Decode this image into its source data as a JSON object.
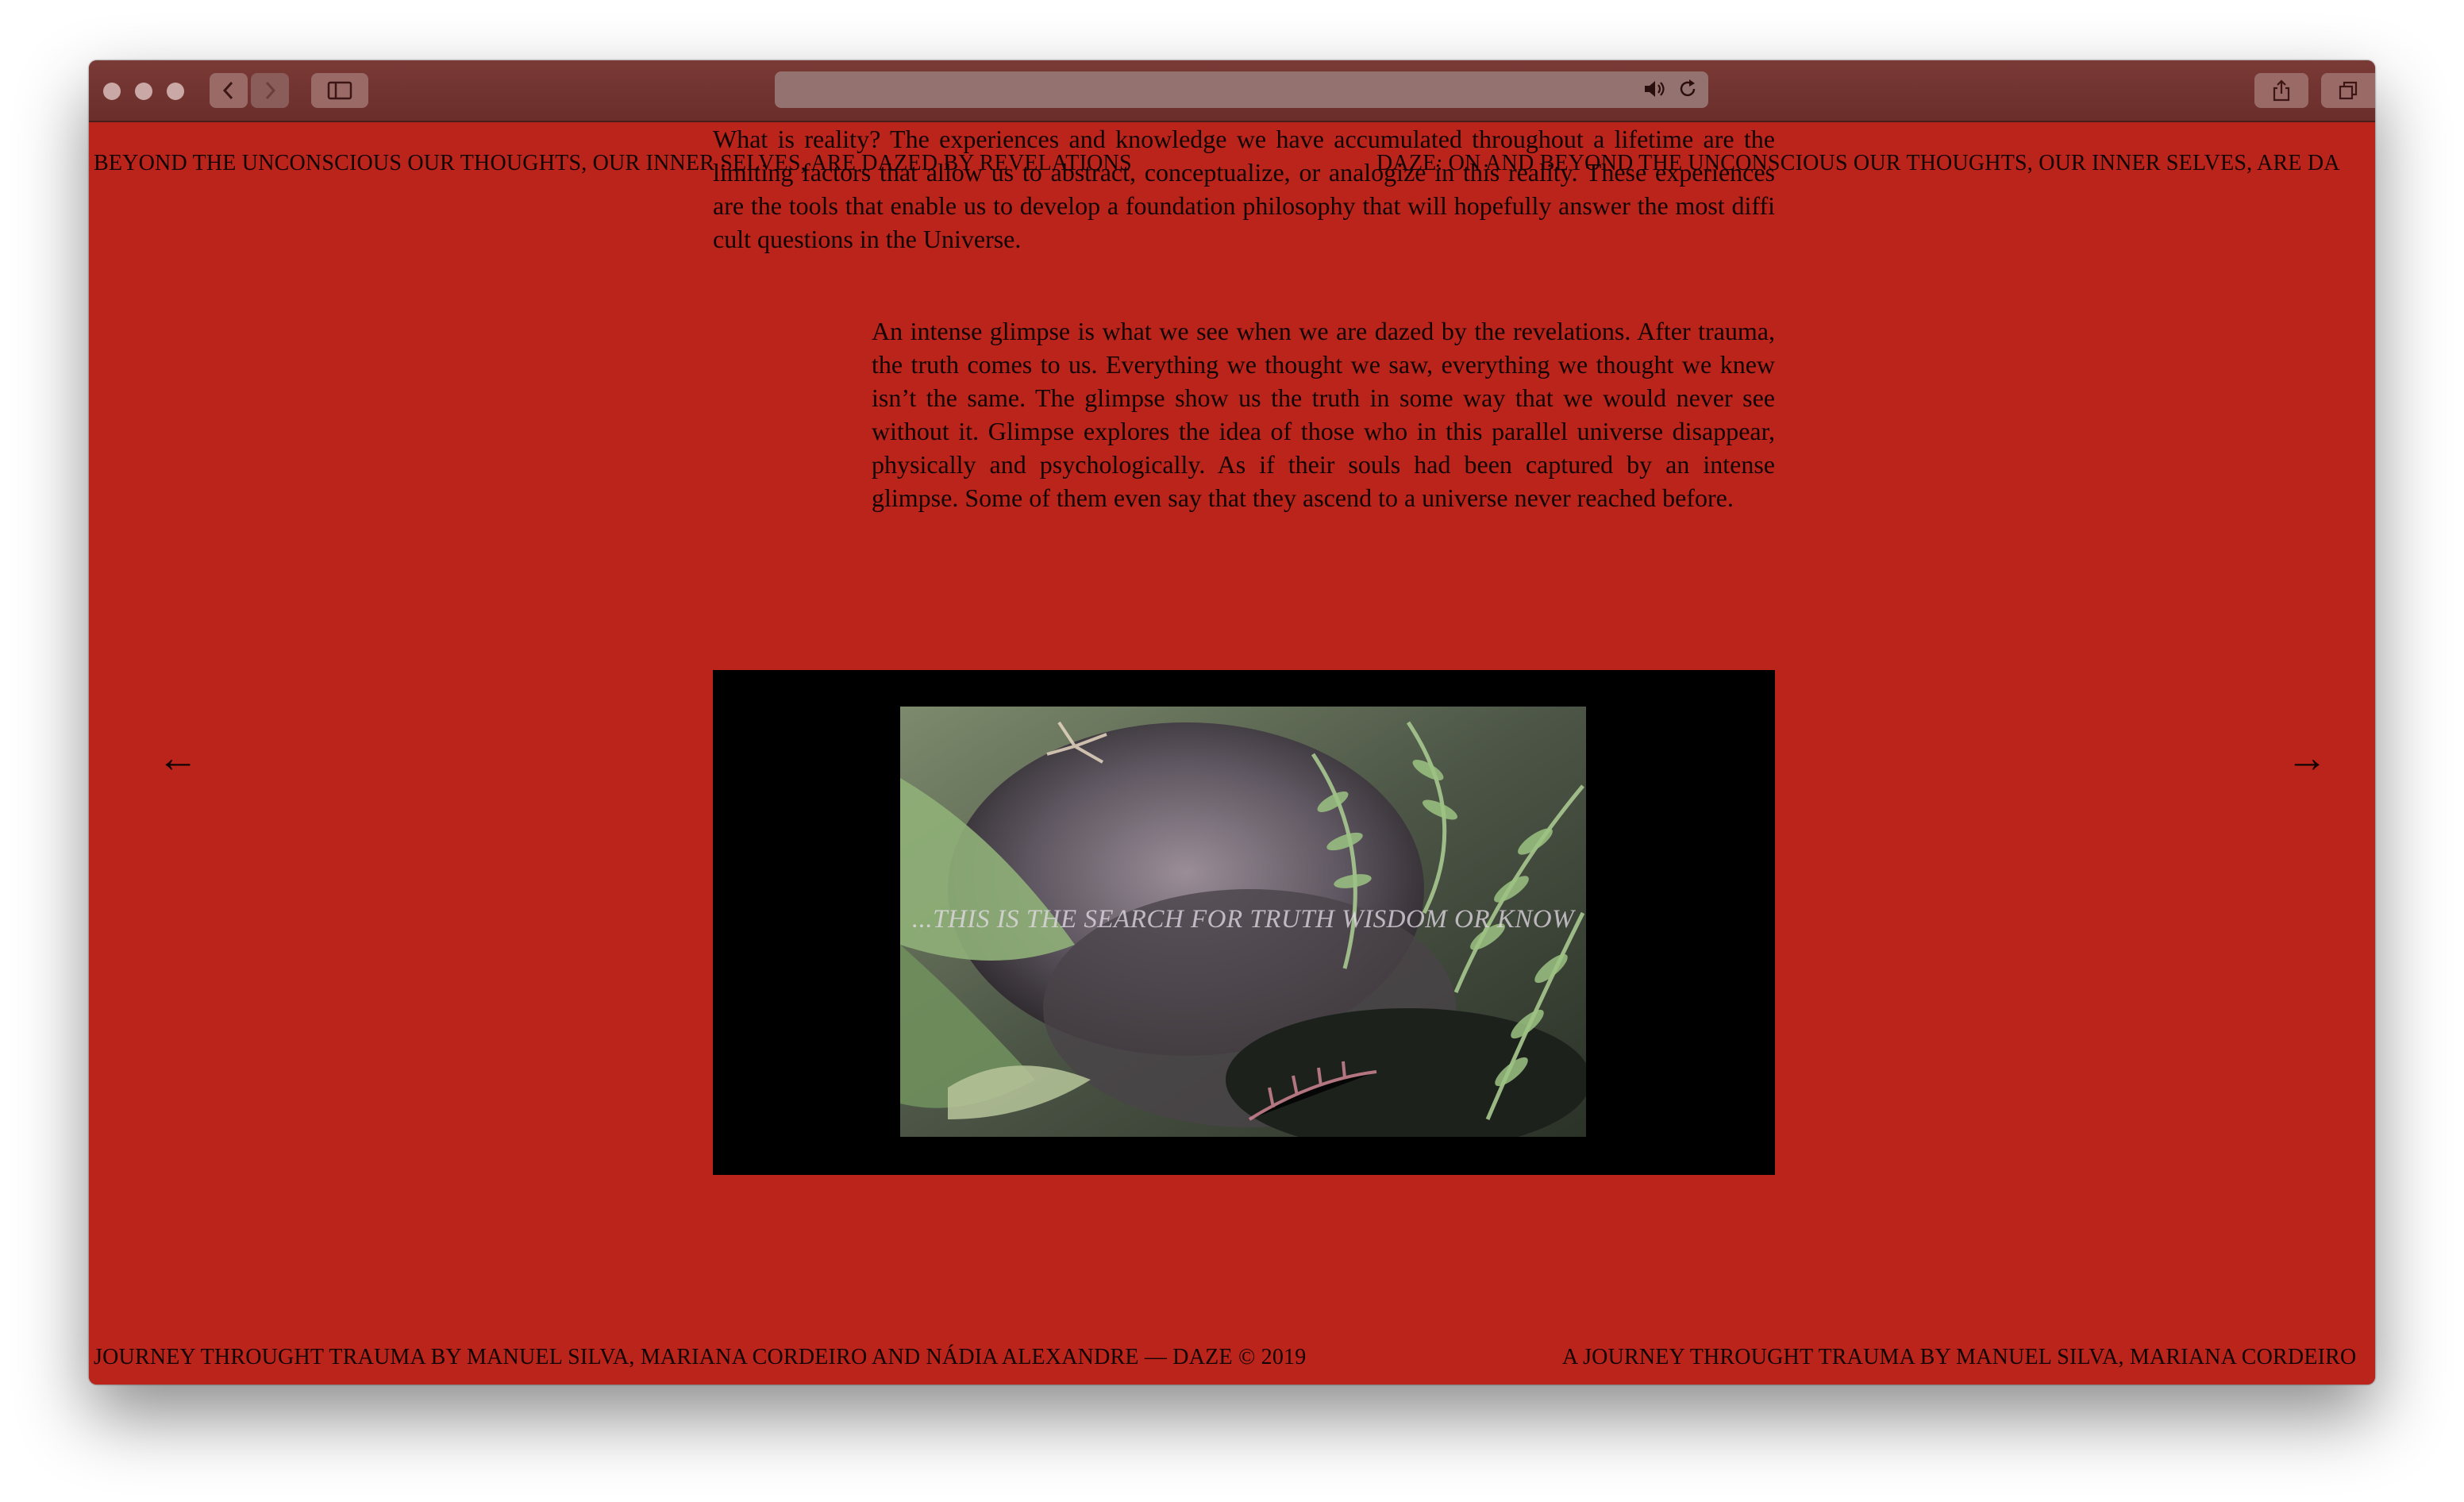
{
  "browser": {
    "back_icon": "chevron-left-icon",
    "forward_icon": "chevron-right-icon",
    "sidebar_icon": "sidebar-icon",
    "audio_icon": "speaker-icon",
    "reload_icon": "reload-icon",
    "share_icon": "share-icon",
    "tabs_icon": "tabs-icon"
  },
  "colors": {
    "page_background": "#ba241a",
    "text": "#120404",
    "toolbar": "#6e302d",
    "video_background": "#000000"
  },
  "page": {
    "top_marquee_left": "BEYOND THE UNCONSCIOUS OUR THOUGHTS, OUR INNER SELVES, ARE DAZED BY REVELATIONS",
    "top_marquee_right": "DAZE: ON AND BEYOND THE UNCONSCIOUS OUR THOUGHTS, OUR INNER SELVES, ARE DA",
    "intro_paragraph": "What is reality? The experiences and knowledge we have accumulated throughout a lifetime are the limiting factors that allow us to abstract, conceptualize, or analogize in this reality. These experiences are the tools that enable us to develop a foundation philosophy that will hopefully answer the most diffi cult questions in the Universe.",
    "glimpse_paragraph": "An intense glimpse is what we see when we are dazed by the revelations. After trauma, the truth comes to us. Everything we thought we saw, everything we thought we knew isn’t the same. The glimpse show us the truth in some way that we would never see without it. Glimpse explores the idea of those who in this parallel universe disappear, physically and psychologically. As if their souls had been captured by an intense glimpse. Some of them even say that they ascend to a universe never reached before.",
    "prev_arrow": "←",
    "next_arrow": "→",
    "video_caption": "...THIS IS THE SEARCH FOR TRUTH WISDOM OR KNOW",
    "footer_left": "JOURNEY THROUGHT TRAUMA BY MANUEL SILVA, MARIANA CORDEIRO AND NÁDIA ALEXANDRE — DAZE © 2019",
    "footer_right": "A JOURNEY THROUGHT TRAUMA BY MANUEL SILVA, MARIANA CORDEIRO"
  }
}
